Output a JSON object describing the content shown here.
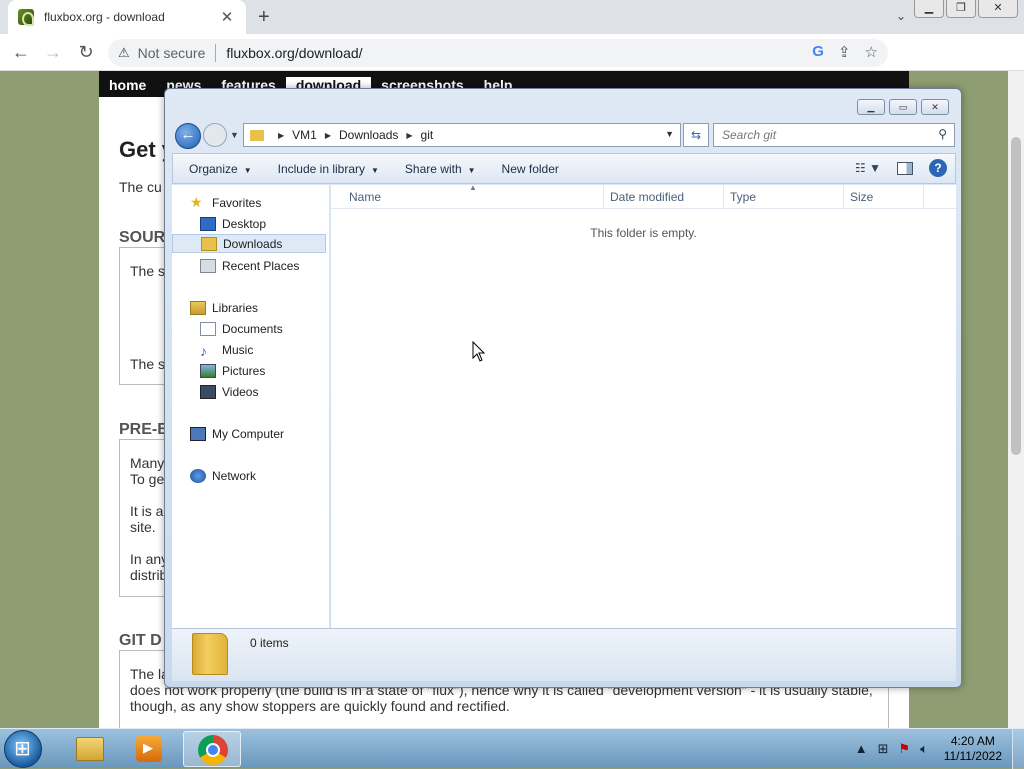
{
  "browser": {
    "tab_title": "fluxbox.org - download",
    "not_secure": "Not secure",
    "url": "fluxbox.org/download/"
  },
  "site": {
    "nav": [
      "home",
      "news",
      "features",
      "download",
      "screenshots",
      "help"
    ],
    "active_nav": "download",
    "heading_partial": "Get y",
    "intro_partial": "The cu",
    "source_heading_partial": "SOUR",
    "source_line1_partial": "The s",
    "source_line2_partial": "The s",
    "prebuilt_heading_partial": "PRE-B",
    "prebuilt_lines_partial": [
      "Many",
      "To ge",
      "It is a",
      "site.",
      "In any",
      "distrib"
    ],
    "git_heading_partial": "GIT D",
    "git_line1_partial": "The la",
    "git_line2": "does not work properly (the build is in a state of \"flux\"), hence why it is called \"development version\" - it is usually stable,",
    "git_line3": "though, as any show stoppers are quickly found and rectified."
  },
  "explorer": {
    "breadcrumb": [
      "VM1",
      "Downloads",
      "git"
    ],
    "search_placeholder": "Search git",
    "commands": {
      "organize": "Organize",
      "include_in_library": "Include in library",
      "share_with": "Share with",
      "new_folder": "New folder"
    },
    "nav": {
      "favorites": "Favorites",
      "desktop": "Desktop",
      "downloads": "Downloads",
      "recent_places": "Recent Places",
      "libraries": "Libraries",
      "documents": "Documents",
      "music": "Music",
      "pictures": "Pictures",
      "videos": "Videos",
      "my_computer": "My Computer",
      "network": "Network"
    },
    "columns": [
      "Name",
      "Date modified",
      "Type",
      "Size"
    ],
    "empty_message": "This folder is empty.",
    "item_count": "0 items"
  },
  "taskbar": {
    "time": "4:20 AM",
    "date": "11/11/2022"
  }
}
